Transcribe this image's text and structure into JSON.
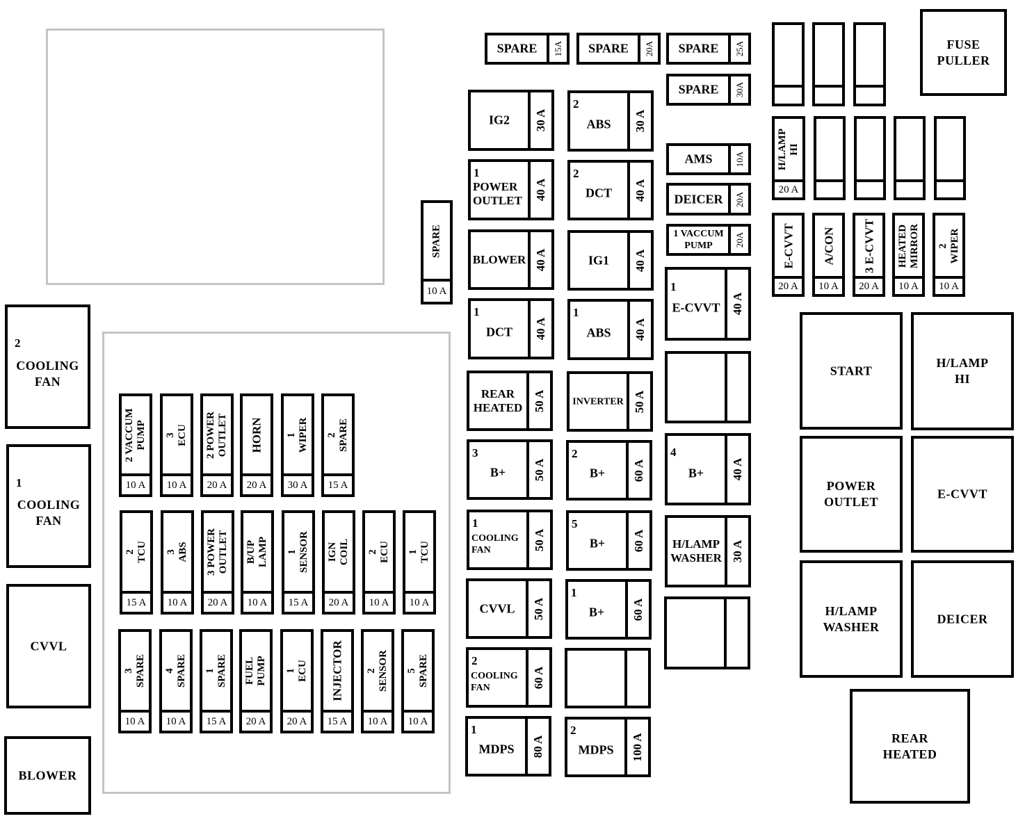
{
  "relays": [
    {
      "num": "2",
      "lines": [
        "COOLING",
        "FAN"
      ]
    },
    {
      "num": "1",
      "lines": [
        "COOLING",
        "FAN"
      ]
    },
    {
      "lines": [
        "CVVL"
      ]
    },
    {
      "lines": [
        "BLOWER"
      ]
    },
    {
      "lines": [
        "START"
      ]
    },
    {
      "lines": [
        "H/LAMP",
        "HI"
      ]
    },
    {
      "lines": [
        "POWER",
        "OUTLET"
      ]
    },
    {
      "lines": [
        "E-CVVT"
      ]
    },
    {
      "lines": [
        "H/LAMP",
        "WASHER"
      ]
    },
    {
      "lines": [
        "DEICER"
      ]
    },
    {
      "lines": [
        "REAR",
        "HEATED"
      ]
    },
    {
      "lines": [
        "FUSE",
        "PULLER"
      ]
    }
  ],
  "small_fuses": [
    {
      "lines": [
        "SPARE"
      ],
      "rating": "15A"
    },
    {
      "lines": [
        "SPARE"
      ],
      "rating": "20A"
    },
    {
      "lines": [
        "SPARE"
      ],
      "rating": "25A"
    },
    {
      "lines": [
        "SPARE"
      ],
      "rating": "30A"
    },
    {
      "lines": [
        "AMS"
      ],
      "rating": "10A"
    },
    {
      "lines": [
        "DEICER"
      ],
      "rating": "20A"
    },
    {
      "lines": [
        "1 VACCUM",
        "PUMP"
      ],
      "rating": "20A"
    }
  ],
  "large_fuses": [
    {
      "lines": [
        "IG2"
      ],
      "rating": "30 A"
    },
    {
      "num": "1",
      "lines": [
        "POWER",
        "OUTLET"
      ],
      "rating": "40 A"
    },
    {
      "lines": [
        "BLOWER"
      ],
      "rating": "40 A"
    },
    {
      "num": "1",
      "lines": [
        "DCT"
      ],
      "rating": "40 A"
    },
    {
      "lines": [
        "REAR",
        "HEATED"
      ],
      "rating": "50 A"
    },
    {
      "num": "3",
      "lines": [
        "B+"
      ],
      "rating": "50 A"
    },
    {
      "num": "1",
      "lines": [
        "COOLING",
        "FAN"
      ],
      "rating": "50 A"
    },
    {
      "lines": [
        "CVVL"
      ],
      "rating": "50 A"
    },
    {
      "num": "2",
      "lines": [
        "COOLING",
        "FAN"
      ],
      "rating": "60 A"
    },
    {
      "num": "1",
      "lines": [
        "MDPS"
      ],
      "rating": "80 A"
    },
    {
      "num": "2",
      "lines": [
        "ABS"
      ],
      "rating": "30 A"
    },
    {
      "num": "2",
      "lines": [
        "DCT"
      ],
      "rating": "40 A"
    },
    {
      "lines": [
        "IG1"
      ],
      "rating": "40 A"
    },
    {
      "num": "1",
      "lines": [
        "ABS"
      ],
      "rating": "40 A"
    },
    {
      "lines": [
        "INVERTER"
      ],
      "rating": "50 A"
    },
    {
      "num": "2",
      "lines": [
        "B+"
      ],
      "rating": "60 A"
    },
    {
      "num": "5",
      "lines": [
        "B+"
      ],
      "rating": "60 A"
    },
    {
      "num": "1",
      "lines": [
        "B+"
      ],
      "rating": "60 A"
    },
    {
      "lines": [],
      "rating": ""
    },
    {
      "num": "2",
      "lines": [
        "MDPS"
      ],
      "rating": "100 A"
    },
    {
      "num": "1",
      "lines": [
        "E-CVVT"
      ],
      "rating": "40 A"
    },
    {
      "lines": [],
      "rating": ""
    },
    {
      "num": "4",
      "lines": [
        "B+"
      ],
      "rating": "40 A"
    },
    {
      "lines": [
        "H/LAMP",
        "WASHER"
      ],
      "rating": "30 A"
    },
    {
      "lines": [],
      "rating": ""
    }
  ],
  "mini_fuses": [
    {
      "lines": [
        "SPARE"
      ],
      "rating": "10 A"
    },
    {
      "lines": [],
      "rating": ""
    },
    {
      "lines": [],
      "rating": ""
    },
    {
      "lines": [],
      "rating": ""
    },
    {
      "lines": [
        "H/LAMP",
        "HI"
      ],
      "rating": "20 A"
    },
    {
      "lines": [],
      "rating": ""
    },
    {
      "lines": [],
      "rating": ""
    },
    {
      "lines": [],
      "rating": ""
    },
    {
      "lines": [],
      "rating": ""
    },
    {
      "lines": [
        "E-CVVT"
      ],
      "rating": "20 A"
    },
    {
      "lines": [
        "A/CON"
      ],
      "rating": "10 A"
    },
    {
      "lines": [
        "3 E-CVVT"
      ],
      "rating": "20 A"
    },
    {
      "lines": [
        "HEATED",
        "MIRROR"
      ],
      "rating": "10 A"
    },
    {
      "lines": [
        "2",
        "WIPER"
      ],
      "rating": "10 A"
    },
    {
      "lines": [
        "2 VACCUM",
        "PUMP"
      ],
      "rating": "10 A"
    },
    {
      "lines": [
        "3",
        "ECU"
      ],
      "rating": "10 A"
    },
    {
      "lines": [
        "2 POWER",
        "OUTLET"
      ],
      "rating": "20 A"
    },
    {
      "lines": [
        "HORN"
      ],
      "rating": "20 A"
    },
    {
      "lines": [
        "1",
        "WIPER"
      ],
      "rating": "30 A"
    },
    {
      "lines": [
        "2",
        "SPARE"
      ],
      "rating": "15 A"
    },
    {
      "lines": [
        "2",
        "TCU"
      ],
      "rating": "15 A"
    },
    {
      "lines": [
        "3",
        "ABS"
      ],
      "rating": "10 A"
    },
    {
      "lines": [
        "3 POWER",
        "OUTLET"
      ],
      "rating": "20 A"
    },
    {
      "lines": [
        "B/UP",
        "LAMP"
      ],
      "rating": "10 A"
    },
    {
      "lines": [
        "1",
        "SENSOR"
      ],
      "rating": "15 A"
    },
    {
      "lines": [
        "IGN",
        "COIL"
      ],
      "rating": "20 A"
    },
    {
      "lines": [
        "2",
        "ECU"
      ],
      "rating": "10 A"
    },
    {
      "lines": [
        "1",
        "TCU"
      ],
      "rating": "10 A"
    },
    {
      "lines": [
        "3",
        "SPARE"
      ],
      "rating": "10 A"
    },
    {
      "lines": [
        "4",
        "SPARE"
      ],
      "rating": "10 A"
    },
    {
      "lines": [
        "1",
        "SPARE"
      ],
      "rating": "15 A"
    },
    {
      "lines": [
        "FUEL",
        "PUMP"
      ],
      "rating": "20 A"
    },
    {
      "lines": [
        "1",
        "ECU"
      ],
      "rating": "20 A"
    },
    {
      "lines": [
        "INJECTOR"
      ],
      "rating": "15 A"
    },
    {
      "lines": [
        "2",
        "SENSOR"
      ],
      "rating": "10 A"
    },
    {
      "lines": [
        "5",
        "SPARE"
      ],
      "rating": "10 A"
    }
  ]
}
